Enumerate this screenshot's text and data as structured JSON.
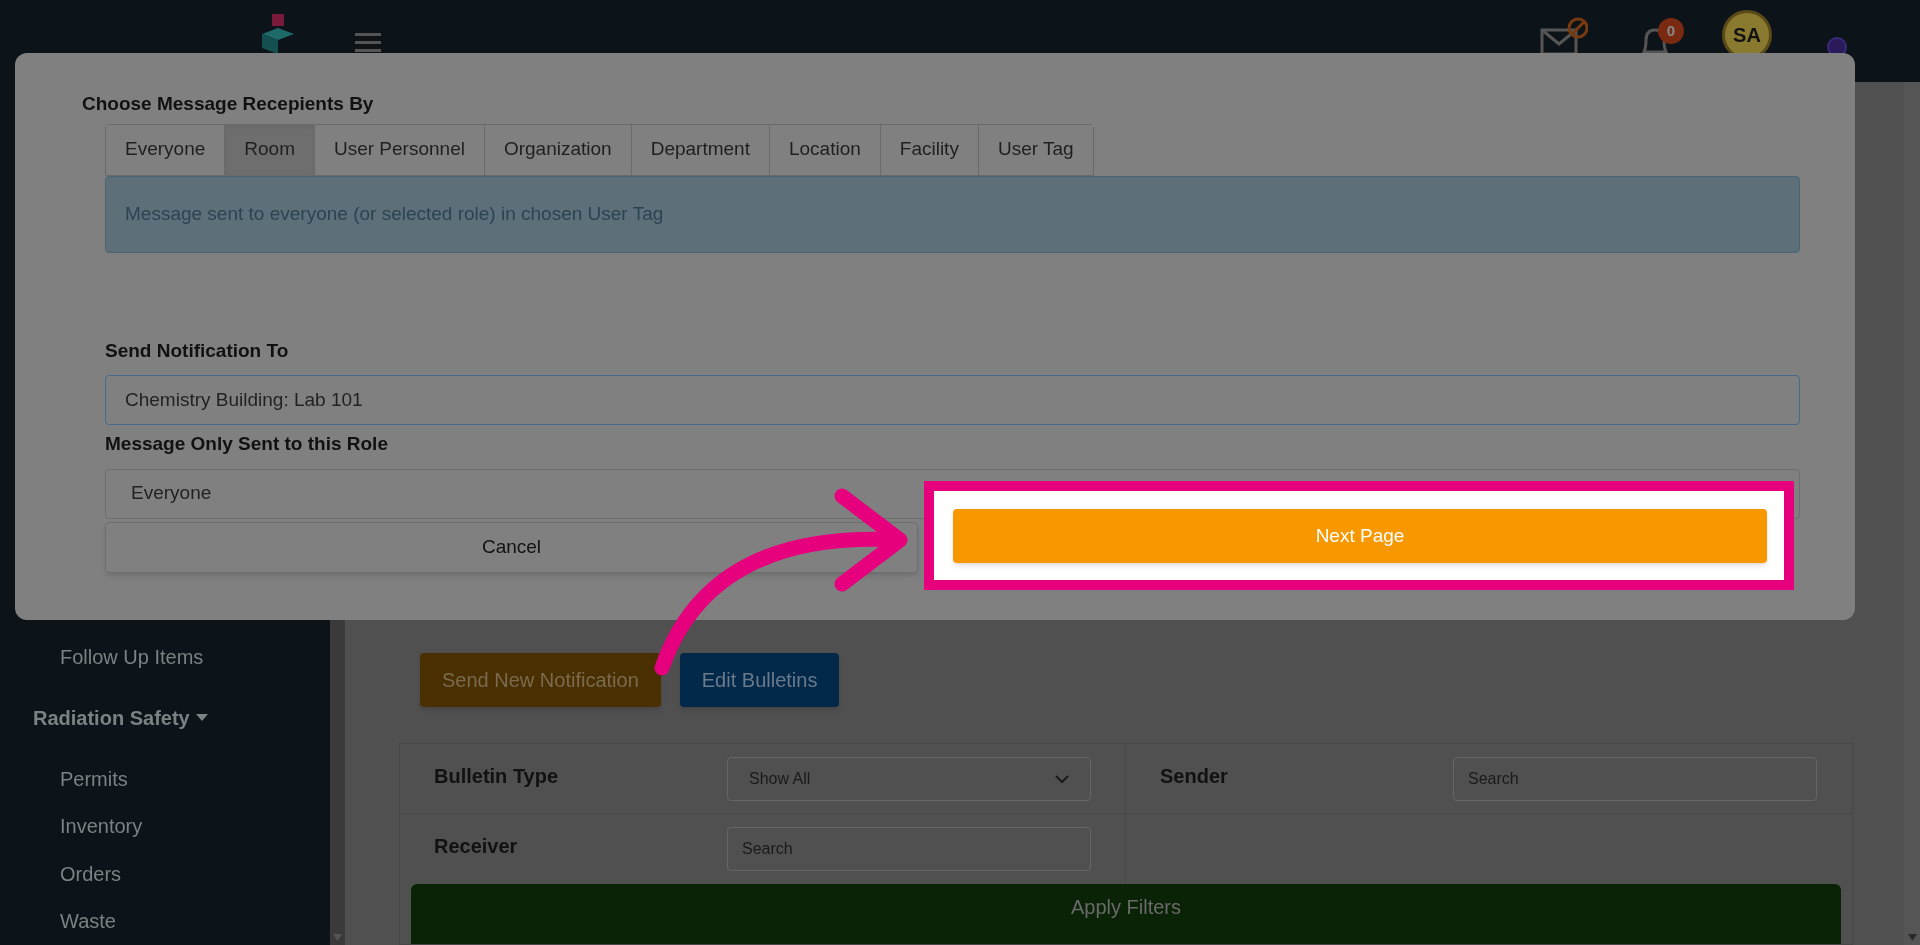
{
  "top_bar": {
    "notification_badge": "0",
    "avatar_initials": "SA"
  },
  "sidebar": {
    "items": [
      {
        "label": "Follow Up Items",
        "kind": "link"
      },
      {
        "label": "Radiation Safety",
        "kind": "section",
        "expanded": true
      },
      {
        "label": "Permits",
        "kind": "link"
      },
      {
        "label": "Inventory",
        "kind": "link"
      },
      {
        "label": "Orders",
        "kind": "link"
      },
      {
        "label": "Waste",
        "kind": "link"
      }
    ]
  },
  "toolbar": {
    "buttons": [
      {
        "label": "Send New Notification",
        "kind": "primary"
      },
      {
        "label": "Edit Bulletins",
        "kind": "secondary"
      }
    ]
  },
  "filters": {
    "bulletin_type": {
      "label": "Bulletin Type",
      "value": "Show All"
    },
    "sender": {
      "label": "Sender",
      "placeholder": "Search"
    },
    "receiver": {
      "label": "Receiver",
      "placeholder": "Search"
    },
    "apply_button": "Apply Filters"
  },
  "modal": {
    "heading": "Choose Message Recepients By",
    "tabs": [
      {
        "label": "Everyone",
        "selected": false
      },
      {
        "label": "Room",
        "selected": true
      },
      {
        "label": "User Personnel",
        "selected": false
      },
      {
        "label": "Organization",
        "selected": false
      },
      {
        "label": "Department",
        "selected": false
      },
      {
        "label": "Location",
        "selected": false
      },
      {
        "label": "Facility",
        "selected": false
      },
      {
        "label": "User Tag",
        "selected": false
      }
    ],
    "info": "Message sent to everyone (or selected role) in chosen User Tag",
    "send_to": {
      "label": "Send Notification To",
      "value": "Chemistry Building: Lab 101"
    },
    "role": {
      "label": "Message Only Sent to this Role",
      "value": "Everyone"
    },
    "cancel_button": "Cancel",
    "next_button": "Next Page"
  }
}
